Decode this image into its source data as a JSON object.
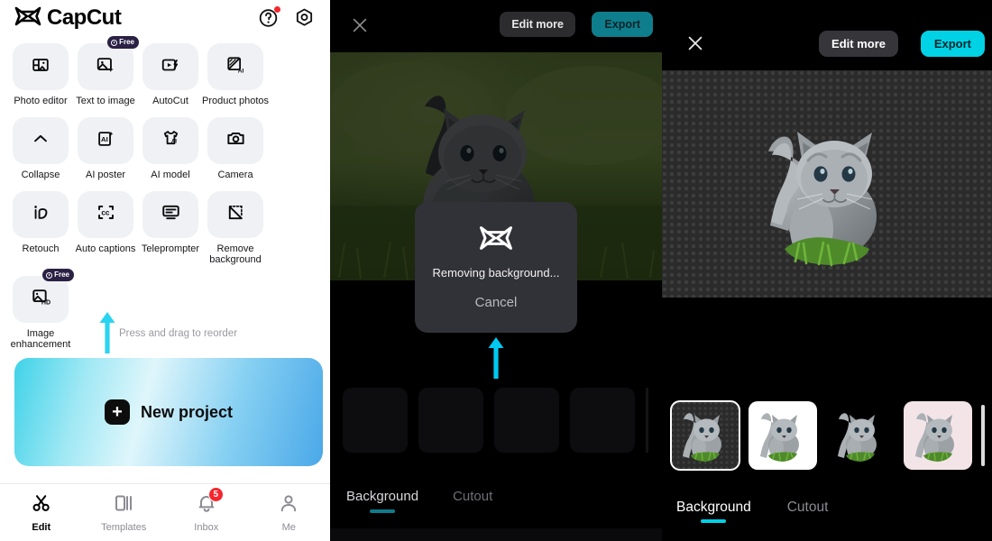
{
  "left_panel": {
    "brand": {
      "name": "CapCut",
      "logo_icon": "capcut-logo-icon"
    },
    "header_icons": [
      {
        "name": "help-icon",
        "glyph": "?",
        "has_dot": true
      },
      {
        "name": "settings-icon",
        "glyph": "gear"
      }
    ],
    "tools": [
      {
        "label": "Photo editor",
        "icon": "photo-editor-icon",
        "badge": ""
      },
      {
        "label": "Text to image",
        "icon": "text-to-image-icon",
        "badge": "Free"
      },
      {
        "label": "AutoCut",
        "icon": "autocut-icon",
        "badge": ""
      },
      {
        "label": "Product photos",
        "icon": "product-photos-ai-icon",
        "badge": ""
      },
      {
        "label": "Collapse",
        "icon": "chevron-up-icon",
        "badge": ""
      },
      {
        "label": "AI poster",
        "icon": "ai-poster-icon",
        "badge": ""
      },
      {
        "label": "AI model",
        "icon": "ai-model-shirt-icon",
        "badge": ""
      },
      {
        "label": "Camera",
        "icon": "camera-icon",
        "badge": ""
      },
      {
        "label": "Retouch",
        "icon": "retouch-icon",
        "badge": ""
      },
      {
        "label": "Auto captions",
        "icon": "auto-captions-cc-icon",
        "badge": ""
      },
      {
        "label": "Teleprompter",
        "icon": "teleprompter-icon",
        "badge": ""
      },
      {
        "label": "Remove background",
        "icon": "remove-background-icon",
        "badge": ""
      },
      {
        "label": "Image enhancement",
        "icon": "image-hd-icon",
        "badge": "Free"
      }
    ],
    "reorder_hint": "Press and drag to reorder",
    "new_project": {
      "label": "New project",
      "plus_icon": "plus-icon"
    },
    "bottom_nav": [
      {
        "label": "Edit",
        "icon": "scissors-icon",
        "active": true,
        "badge": ""
      },
      {
        "label": "Templates",
        "icon": "templates-icon",
        "active": false,
        "badge": ""
      },
      {
        "label": "Inbox",
        "icon": "bell-icon",
        "active": false,
        "badge": "5"
      },
      {
        "label": "Me",
        "icon": "person-icon",
        "active": false,
        "badge": ""
      }
    ]
  },
  "middle_panel": {
    "close_icon": "close-icon",
    "edit_more_label": "Edit more",
    "export_label": "Export",
    "dialog": {
      "logo_icon": "capcut-logo-icon",
      "status_text": "Removing background...",
      "cancel_label": "Cancel"
    },
    "annotation_arrow_icon": "up-arrow-annotation-icon",
    "tabs": [
      {
        "label": "Background",
        "active": true
      },
      {
        "label": "Cutout",
        "active": false
      }
    ]
  },
  "right_panel": {
    "close_icon": "close-icon",
    "edit_more_label": "Edit more",
    "export_label": "Export",
    "canvas_icon": "cutout-kitten-preview",
    "thumbnails": [
      {
        "name": "transparent-background-thumbnail",
        "style": "bg-checker",
        "selected": true
      },
      {
        "name": "white-background-thumbnail",
        "style": "bg-white",
        "selected": false
      },
      {
        "name": "black-background-thumbnail",
        "style": "bg-black",
        "selected": false
      },
      {
        "name": "pink-background-thumbnail",
        "style": "bg-pink",
        "selected": false
      }
    ],
    "tabs": [
      {
        "label": "Background",
        "active": true
      },
      {
        "label": "Cutout",
        "active": false
      }
    ]
  },
  "colors": {
    "accent_cyan": "#00d2e6",
    "teal_export": "#0f7e8c",
    "badge_red": "#f5262e",
    "free_badge": "#2b2144",
    "tile_gray": "#eff1f5"
  }
}
